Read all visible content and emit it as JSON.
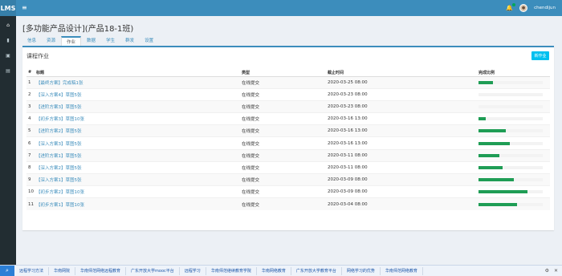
{
  "app": {
    "logo": "LMS",
    "username": "chendijun"
  },
  "sidebar": {
    "icons": [
      {
        "name": "home-icon",
        "glyph": "⌂"
      },
      {
        "name": "book-icon",
        "glyph": "▮"
      },
      {
        "name": "calendar-icon",
        "glyph": "▣"
      },
      {
        "name": "document-icon",
        "glyph": "▤"
      }
    ]
  },
  "page": {
    "title": "[多功能产品设计](产品18-1班)"
  },
  "tabs": [
    "信息",
    "资源",
    "作业",
    "数据",
    "学生",
    "群发",
    "设置"
  ],
  "active_tab": "作业",
  "assignments": {
    "title": "课程作业",
    "new_button": "新作业",
    "columns": {
      "num": "#",
      "title": "标题",
      "type": "类型",
      "deadline": "截止时间",
      "completion": "完成比例"
    },
    "rows": [
      {
        "num": "1",
        "title": "【最终方案】完成稿1张",
        "type": "在线提交",
        "deadline": "2020-03-25 08:00",
        "completion": 0.22
      },
      {
        "num": "2",
        "title": "【深入方案4】草图5张",
        "type": "在线提交",
        "deadline": "2020-03-23 08:00",
        "completion": 0
      },
      {
        "num": "3",
        "title": "【进阶方案3】草图5张",
        "type": "在线提交",
        "deadline": "2020-03-23 08:00",
        "completion": 0
      },
      {
        "num": "4",
        "title": "【初步方案3】草图10张",
        "type": "在线提交",
        "deadline": "2020-03-16 13:00",
        "completion": 0.11
      },
      {
        "num": "5",
        "title": "【进阶方案2】草图5张",
        "type": "在线提交",
        "deadline": "2020-03-16 13:00",
        "completion": 0.43
      },
      {
        "num": "6",
        "title": "【深入方案3】草图5张",
        "type": "在线提交",
        "deadline": "2020-03-16 13:00",
        "completion": 0.49
      },
      {
        "num": "7",
        "title": "【进阶方案1】草图5张",
        "type": "在线提交",
        "deadline": "2020-03-11 08:00",
        "completion": 0.33
      },
      {
        "num": "8",
        "title": "【深入方案2】草图5张",
        "type": "在线提交",
        "deadline": "2020-03-11 08:00",
        "completion": 0.38
      },
      {
        "num": "9",
        "title": "【深入方案1】草图5张",
        "type": "在线提交",
        "deadline": "2020-03-09 08:00",
        "completion": 0.55
      },
      {
        "num": "10",
        "title": "【初步方案2】草图10张",
        "type": "在线提交",
        "deadline": "2020-03-09 08:00",
        "completion": 0.76
      },
      {
        "num": "11",
        "title": "【初步方案1】草图10张",
        "type": "在线提交",
        "deadline": "2020-03-04 08:00",
        "completion": 0.6
      }
    ]
  },
  "bottom_bar": {
    "links": [
      "远程学习方法",
      "华南网院",
      "华南师范网络远程教育",
      "广东开放大学mooc平台",
      "远程学习",
      "华南师范继续教育学院",
      "华南网络教育",
      "广东开放大学教育平台",
      "网络学习的优势",
      "华南师范网络教育"
    ]
  }
}
